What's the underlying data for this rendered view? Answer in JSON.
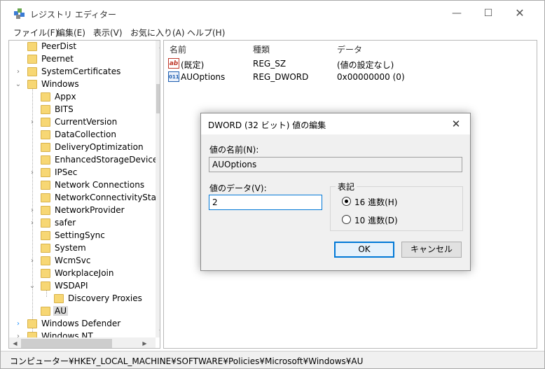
{
  "window": {
    "title": "レジストリ エディター",
    "controls": {
      "minimize": "—",
      "maximize": "☐",
      "close": "✕"
    }
  },
  "menu": [
    "ファイル(F)",
    "編集(E)",
    "表示(V)",
    "お気に入り(A)",
    "ヘルプ(H)"
  ],
  "tree": {
    "items": [
      {
        "label": "PeerDist",
        "expander": ""
      },
      {
        "label": "Peernet",
        "expander": ""
      },
      {
        "label": "SystemCertificates",
        "expander": "›"
      },
      {
        "label": "Windows",
        "expander": "⌄"
      },
      {
        "label": "Appx",
        "expander": ""
      },
      {
        "label": "BITS",
        "expander": ""
      },
      {
        "label": "CurrentVersion",
        "expander": "›"
      },
      {
        "label": "DataCollection",
        "expander": ""
      },
      {
        "label": "DeliveryOptimization",
        "expander": ""
      },
      {
        "label": "EnhancedStorageDevices",
        "expander": ""
      },
      {
        "label": "IPSec",
        "expander": "›"
      },
      {
        "label": "Network Connections",
        "expander": ""
      },
      {
        "label": "NetworkConnectivityStat",
        "expander": ""
      },
      {
        "label": "NetworkProvider",
        "expander": "›"
      },
      {
        "label": "safer",
        "expander": "›"
      },
      {
        "label": "SettingSync",
        "expander": ""
      },
      {
        "label": "System",
        "expander": ""
      },
      {
        "label": "WcmSvc",
        "expander": "›"
      },
      {
        "label": "WorkplaceJoin",
        "expander": ""
      },
      {
        "label": "WSDAPI",
        "expander": "⌄"
      },
      {
        "label": "Discovery Proxies",
        "expander": ""
      },
      {
        "label": "AU",
        "expander": ""
      },
      {
        "label": "Windows Defender",
        "expander": "›"
      },
      {
        "label": "Windows NT",
        "expander": "›"
      }
    ]
  },
  "list": {
    "headers": {
      "name": "名前",
      "type": "種類",
      "data": "データ"
    },
    "rows": [
      {
        "name": "(既定)",
        "type": "REG_SZ",
        "data": "(値の設定なし)",
        "icon": "ab-string-icon",
        "icon_text": "ab"
      },
      {
        "name": "AUOptions",
        "type": "REG_DWORD",
        "data": "0x00000000 (0)",
        "icon": "binary-value-icon",
        "icon_text": "011"
      }
    ]
  },
  "status": {
    "path": "コンピューター¥HKEY_LOCAL_MACHINE¥SOFTWARE¥Policies¥Microsoft¥Windows¥AU"
  },
  "dialog": {
    "title": "DWORD (32 ビット) 値の編集",
    "close": "✕",
    "name_label": "値の名前(N):",
    "name_value": "AUOptions",
    "data_label": "値のデータ(V):",
    "data_value": "2",
    "base_label": "表記",
    "radio_hex": "16 進数(H)",
    "radio_dec": "10 進数(D)",
    "ok": "OK",
    "cancel": "キャンセル"
  },
  "colors": {
    "folder": "#f7d774",
    "accent": "#0078d7"
  }
}
